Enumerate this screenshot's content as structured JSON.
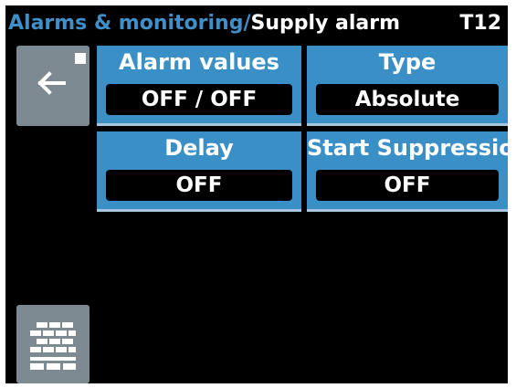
{
  "header": {
    "breadcrumb_parent": "Alarms & monitoring/",
    "breadcrumb_current": "Supply alarm",
    "device_id": "T12"
  },
  "buttons": {
    "back_icon": "arrow-left-icon",
    "keypad_icon": "keypad-icon"
  },
  "tiles": [
    {
      "label": "Alarm values",
      "value": "OFF / OFF"
    },
    {
      "label": "Type",
      "value": "Absolute"
    },
    {
      "label": "Delay",
      "value": "OFF"
    },
    {
      "label": "Start Suppression",
      "value": "OFF"
    }
  ],
  "colors": {
    "accent": "#3a8fc7",
    "breadcrumb": "#3f8fc8",
    "button_gray": "#7e8a91",
    "background": "#000000",
    "text": "#ffffff"
  }
}
